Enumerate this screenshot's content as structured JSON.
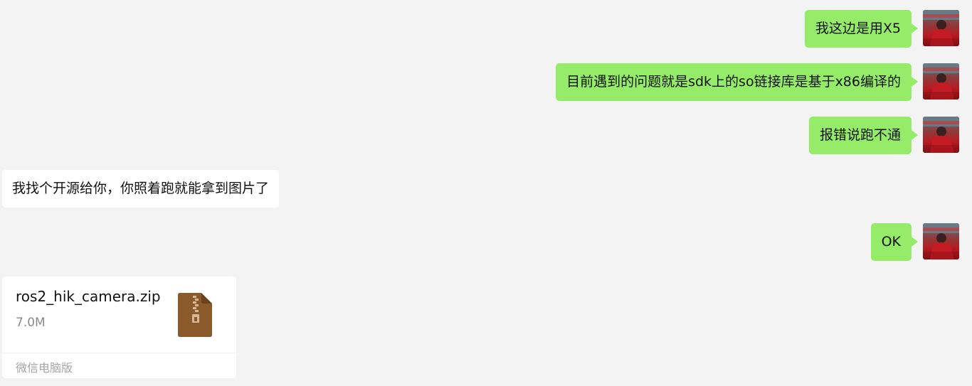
{
  "colors": {
    "background": "#f3f3f3",
    "outgoing_bubble": "#95ec69",
    "incoming_bubble": "#ffffff",
    "file_icon": "#8b5a2b"
  },
  "messages": [
    {
      "direction": "out",
      "text": "我这边是用X5"
    },
    {
      "direction": "out",
      "text": "目前遇到的问题就是sdk上的so链接库是基于x86编译的"
    },
    {
      "direction": "out",
      "text": "报错说跑不通"
    },
    {
      "direction": "in",
      "text": "我找个开源给你，你照着跑就能拿到图片了"
    },
    {
      "direction": "out",
      "text": "OK"
    }
  ],
  "file_message": {
    "direction": "in",
    "file_name": "ros2_hik_camera.zip",
    "file_size": "7.0M",
    "footer": "微信电脑版",
    "icon": "zip-file-icon"
  }
}
